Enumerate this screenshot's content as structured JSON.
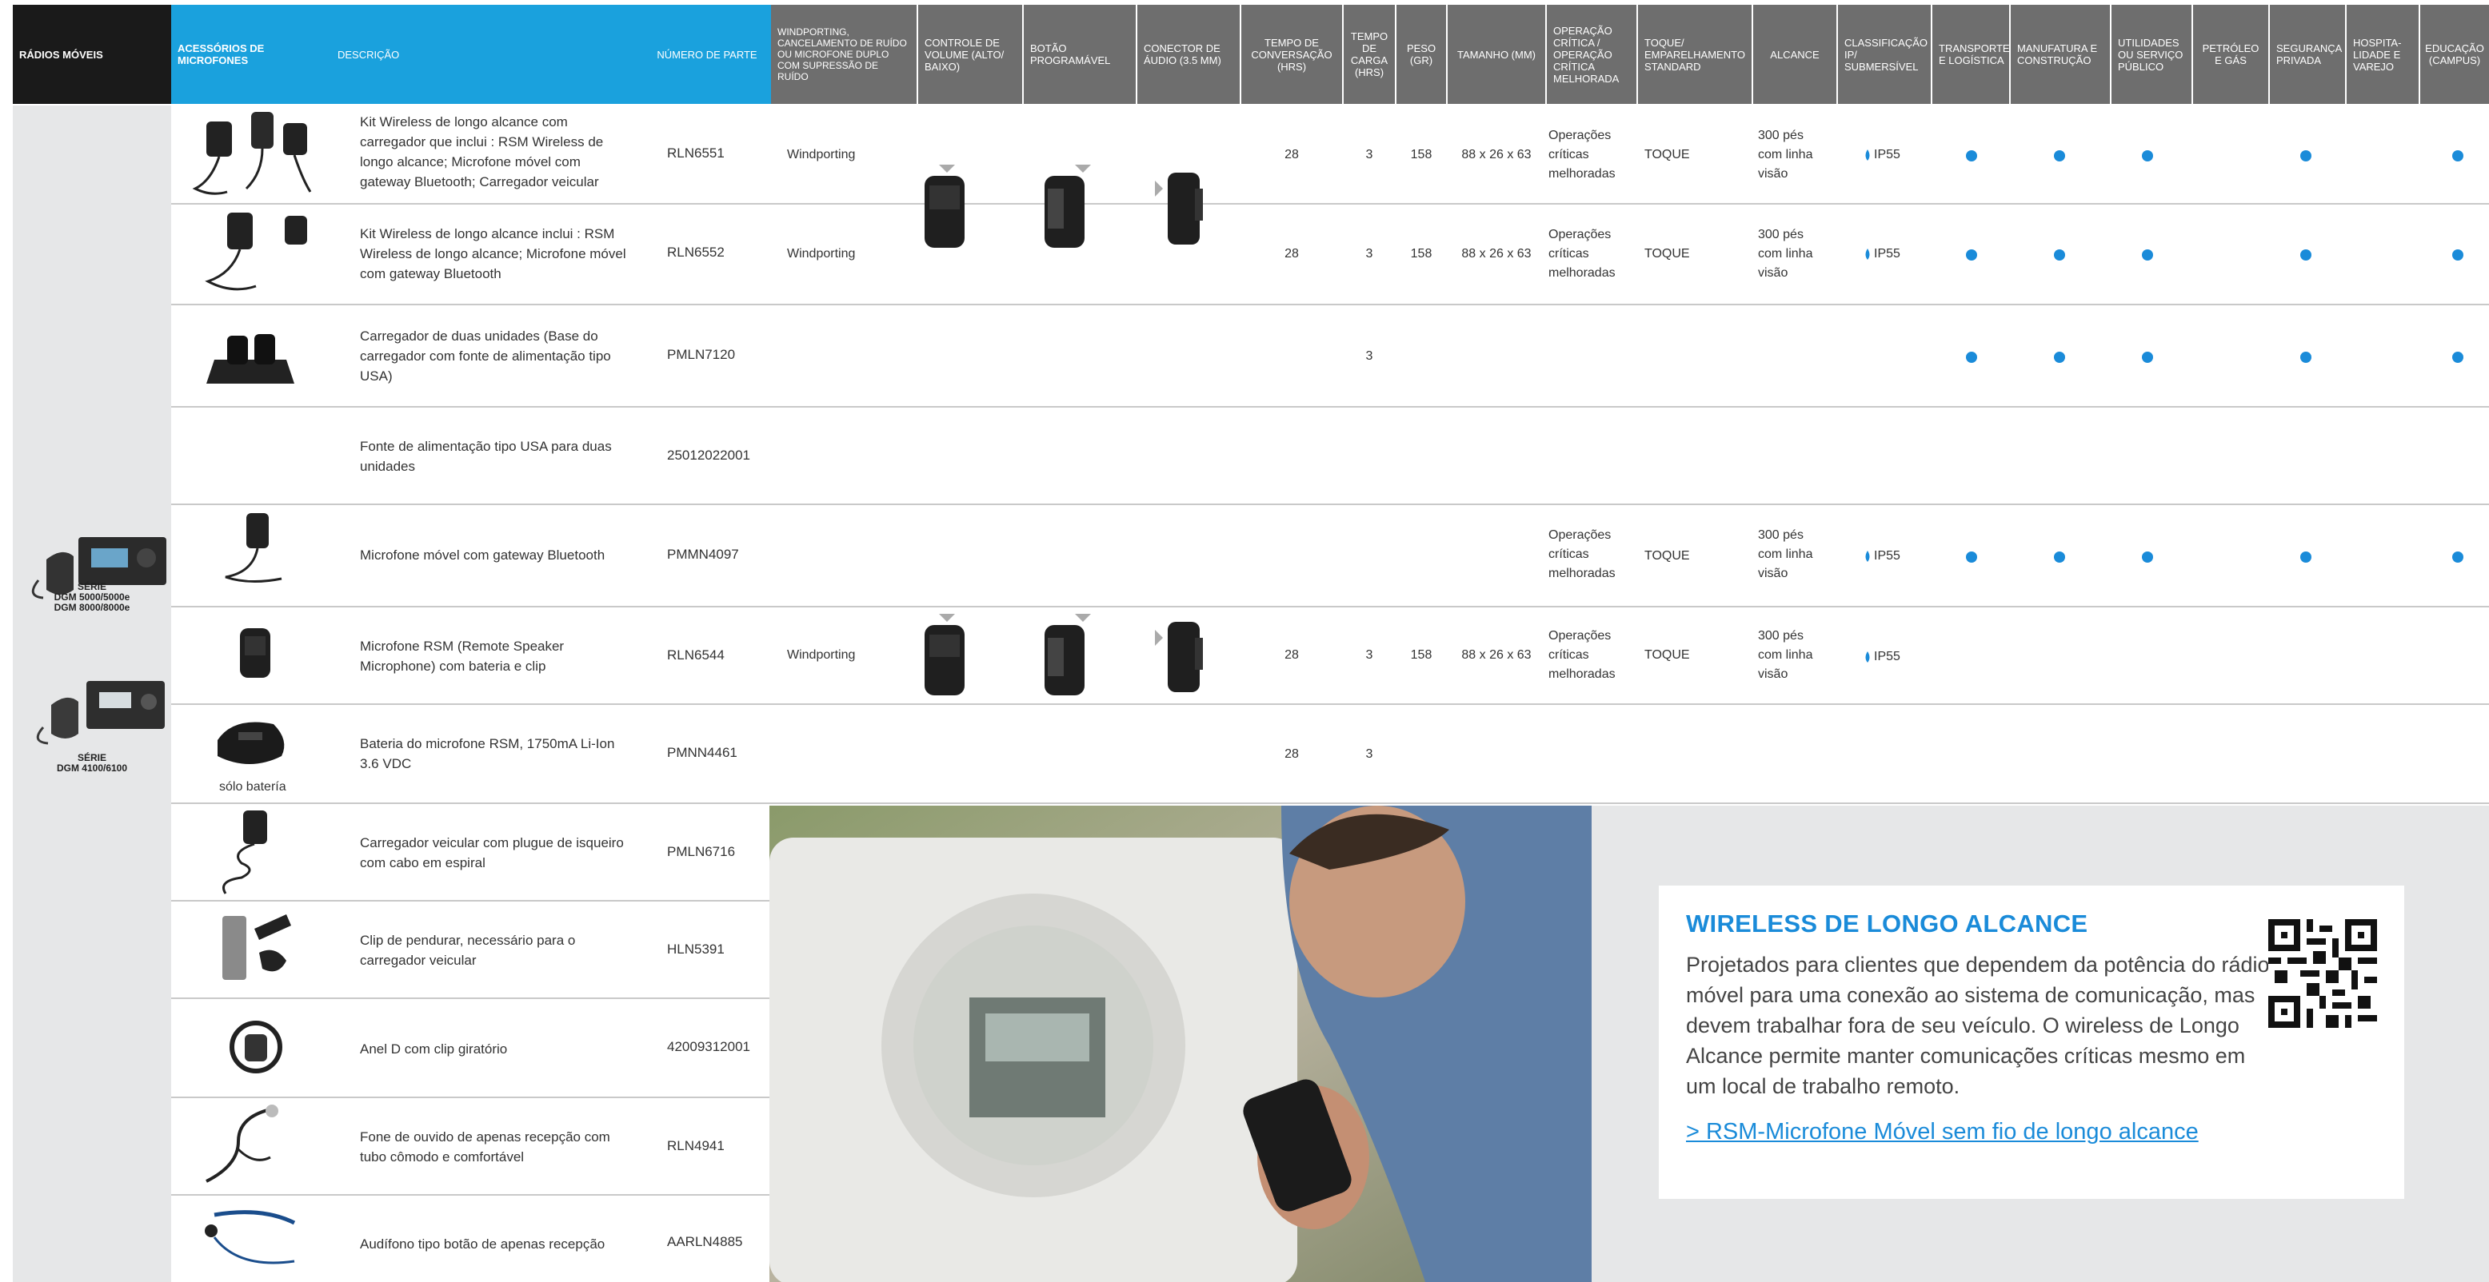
{
  "headers": {
    "radios": "RÁDIOS MÓVEIS",
    "accessories": "ACESSÓRIOS DE MICROFONES",
    "description": "DESCRIÇÃO",
    "part": "NÚMERO DE PARTE",
    "windporting": "WINDPORTING, CANCELAMENTO DE RUÍDO OU MICROFONE DUPLO COM SUPRESSÃO DE RUÍDO",
    "volume": "CONTROLE DE VOLUME (ALTO/ BAIXO)",
    "prog_button": "BOTÃO PROGRAMÁVEL",
    "audio_conn": "CONECTOR DE ÁUDIO (3.5 MM)",
    "talk_time": "TEMPO DE CONVERSAÇÃO (HRS)",
    "charge_time": "TEMPO DE CARGA (HRS)",
    "weight": "PESO (GR)",
    "size": "TAMANHO (MM)",
    "critical_op": "OPERAÇÃO CRÍTICA / OPERAÇÃO CRÍTICA MELHORADA",
    "pairing": "TOQUE/ EMPARELHAMENTO STANDARD",
    "range": "ALCANCE",
    "ip_rating": "CLASSIFICAÇÃO IP/ SUBMERSÍVEL",
    "transport": "TRANSPORTE E LOGÍSTICA",
    "manufacturing": "MANUFATURA E CONSTRUÇÃO",
    "utilities": "UTILIDADES OU SERVIÇO PÚBLICO",
    "oil_gas": "PETRÓLEO E GÁS",
    "security": "SEGURANÇA PRIVADA",
    "hospitality": "HOSPITA- LIDADE E VAREJO",
    "education": "EDUCAÇÃO (CAMPUS)"
  },
  "series": {
    "a": [
      "SÉRIE",
      "DGM 5000/5000e",
      "DGM 8000/8000e"
    ],
    "b": [
      "SÉRIE",
      "DGM 4100/6100"
    ]
  },
  "rows": [
    {
      "desc": "Kit Wireless de longo alcance com carregador que inclui : RSM Wireless de longo alcance; Microfone móvel com gateway Bluetooth; Carregador veicular",
      "part": "RLN6551",
      "wind": "Windporting",
      "talk": "28",
      "charge": "3",
      "weight": "158",
      "size": "88 x 26 x 63",
      "critical": "Operações críticas melhoradas",
      "pair": "TOQUE",
      "range": "300 pés com linha visão",
      "ip": "IP55"
    },
    {
      "desc": "Kit Wireless de longo alcance inclui : RSM Wireless de longo alcance; Microfone móvel com gateway Bluetooth",
      "part": "RLN6552",
      "wind": "Windporting",
      "talk": "28",
      "charge": "3",
      "weight": "158",
      "size": "88 x 26 x 63",
      "critical": "Operações críticas melhoradas",
      "pair": "TOQUE",
      "range": "300 pés com linha visão",
      "ip": "IP55"
    },
    {
      "desc": "Carregador de duas unidades (Base do carregador com fonte de alimentação tipo USA)",
      "part": "PMLN7120",
      "charge": "3"
    },
    {
      "desc": "Fonte de alimentação tipo USA para duas unidades",
      "part": "25012022001"
    },
    {
      "desc": "Microfone móvel com gateway Bluetooth",
      "part": "PMMN4097",
      "critical": "Operações críticas melhoradas",
      "pair": "TOQUE",
      "range": "300 pés com linha visão",
      "ip": "IP55"
    },
    {
      "desc": "Microfone RSM (Remote Speaker Microphone) com bateria e clip",
      "part": "RLN6544",
      "wind": "Windporting",
      "talk": "28",
      "charge": "3",
      "weight": "158",
      "size": "88 x 26 x 63",
      "critical": "Operações críticas melhoradas",
      "pair": "TOQUE",
      "range": "300 pés com linha visão",
      "ip": "IP55"
    },
    {
      "desc": "Bateria do microfone RSM, 1750mA Li-Ion 3.6 VDC",
      "part": "PMNN4461",
      "talk": "28",
      "charge": "3",
      "note": "sólo batería"
    },
    {
      "desc": "Carregador veicular com plugue de isqueiro com cabo em espiral",
      "part": "PMLN6716"
    },
    {
      "desc": "Clip de pendurar, necessário para o carregador veicular",
      "part": "HLN5391"
    },
    {
      "desc": "Anel D com clip giratório",
      "part": "42009312001"
    },
    {
      "desc": "Fone de ouvido de apenas recepção com tubo cômodo e comfortável",
      "part": "RLN4941"
    },
    {
      "desc": "Audífono tipo botão de apenas recepção",
      "part": "AARLN4885"
    }
  ],
  "card": {
    "title": "WIRELESS DE LONGO ALCANCE",
    "body": "Projetados para clientes que dependem da potência do rádio móvel para uma conexão ao sistema de comunicação, mas devem trabalhar fora de seu veículo. O wireless de Longo Alcance permite manter comunicações críticas mesmo em um local de trabalho remoto.",
    "link": "> RSM-Microfone Móvel sem fio de longo alcance"
  },
  "colors": {
    "blue": "#1aa1dd",
    "dot": "#1a8bd9",
    "grey": "#6e6e6e",
    "black": "#1a1a1a"
  }
}
